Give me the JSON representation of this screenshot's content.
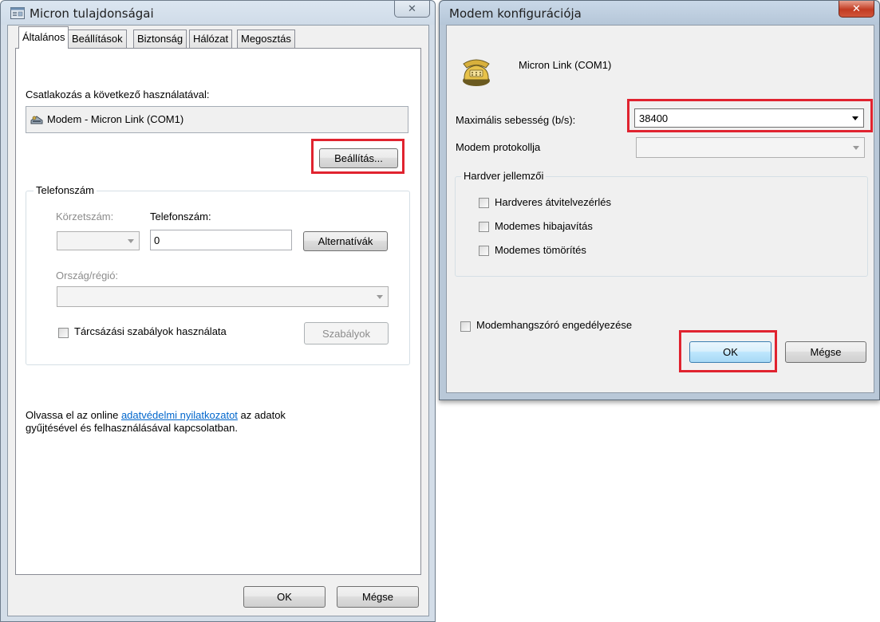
{
  "win1": {
    "title": "Micron tulajdonságai",
    "tabs": [
      {
        "label": "Általános"
      },
      {
        "label": "Beállítások"
      },
      {
        "label": "Biztonság"
      },
      {
        "label": "Hálózat"
      },
      {
        "label": "Megosztás"
      }
    ],
    "connect_label": "Csatlakozás a következő használatával:",
    "device_name": "Modem - Micron Link (COM1)",
    "settings_button": "Beállítás...",
    "phone_group_label": "Telefonszám",
    "area_code_label": "Körzetszám:",
    "phone_label": "Telefonszám:",
    "phone_value": "0",
    "alternatives_button": "Alternatívák",
    "country_label": "Ország/régió:",
    "dialing_rules_label": "Tárcsázási szabályok használata",
    "rules_button": "Szabályok",
    "privacy_text_before": "Olvassa el az online ",
    "privacy_link": "adatvédelmi nyilatkozatot",
    "privacy_text_after": " az adatok",
    "privacy_text_line2": "gyűjtésével és felhasználásával kapcsolatban.",
    "ok_button": "OK",
    "cancel_button": "Mégse"
  },
  "win2": {
    "title": "Modem konfigurációja",
    "modem_name": "Micron Link (COM1)",
    "max_speed_label": "Maximális sebesség (b/s):",
    "max_speed_value": "38400",
    "protocol_label": "Modem protokollja",
    "hardware_group_label": "Hardver jellemzői",
    "hw_flow_control": "Hardveres átvitelvezérlés",
    "error_correction": "Modemes hibajavítás",
    "compression": "Modemes tömörítés",
    "speaker_label": "Modemhangszóró engedélyezése",
    "ok_button": "OK",
    "cancel_button": "Mégse"
  },
  "colors": {
    "highlight": "#e0232f",
    "link": "#0066cc",
    "close_button_red": "#c23b22"
  }
}
